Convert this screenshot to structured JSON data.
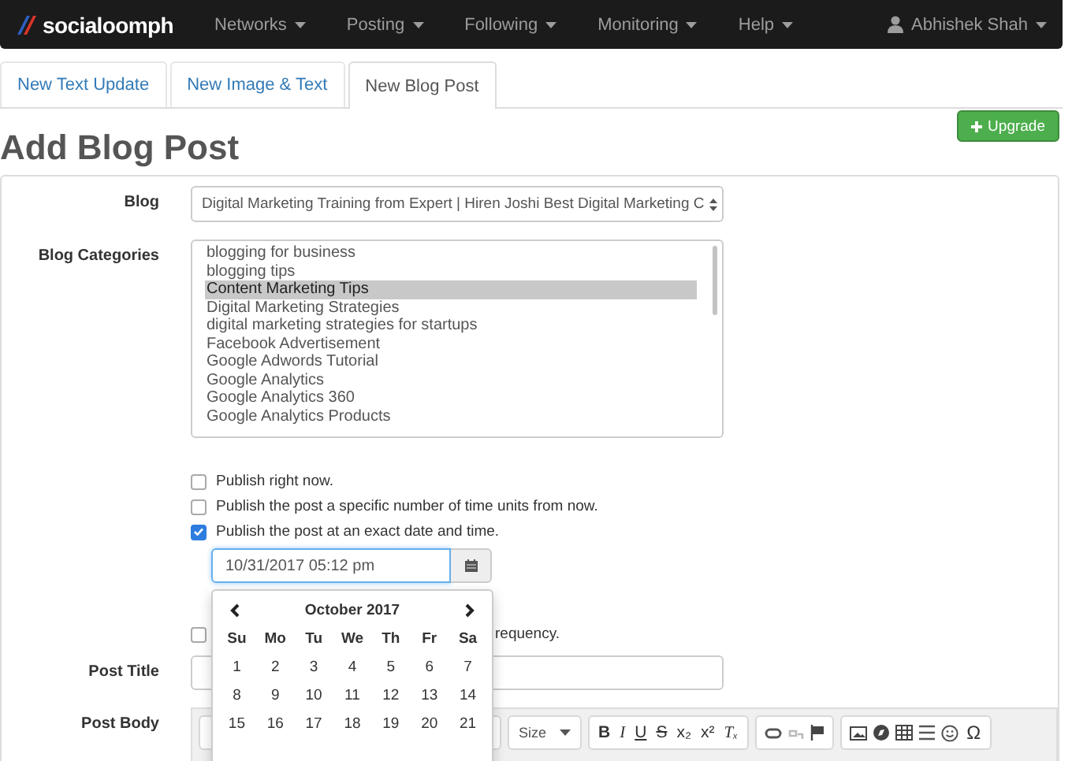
{
  "navbar": {
    "logo": "socialoomph",
    "menus": [
      "Networks",
      "Posting",
      "Following",
      "Monitoring",
      "Help"
    ],
    "user": "Abhishek Shah"
  },
  "tabs": [
    {
      "label": "New Text Update",
      "selected": false
    },
    {
      "label": "New Image & Text",
      "selected": false
    },
    {
      "label": "New Blog Post",
      "selected": true
    }
  ],
  "upgrade_button": "Upgrade",
  "heading": "Add Blog Post",
  "blog": {
    "label": "Blog",
    "value": "Digital Marketing Training from Expert | Hiren Joshi Best Digital Marketing C"
  },
  "categories": {
    "label": "Blog Categories",
    "items": [
      {
        "label": "blogging for business",
        "selected": false
      },
      {
        "label": "blogging tips",
        "selected": false
      },
      {
        "label": "Content Marketing Tips",
        "selected": true
      },
      {
        "label": "Digital Marketing Strategies",
        "selected": false
      },
      {
        "label": "digital marketing strategies for startups",
        "selected": false
      },
      {
        "label": "Facebook Advertisement",
        "selected": false
      },
      {
        "label": "Google Adwords Tutorial",
        "selected": false
      },
      {
        "label": "Google Analytics",
        "selected": false
      },
      {
        "label": "Google Analytics 360",
        "selected": false
      },
      {
        "label": "Google Analytics Products",
        "selected": false
      }
    ]
  },
  "publish_options": [
    {
      "label": "Publish right now.",
      "checked": false
    },
    {
      "label": "Publish the post a specific number of time units from now.",
      "checked": false
    },
    {
      "label": "Publish the post at an exact date and time.",
      "checked": true
    }
  ],
  "date_field": {
    "value": "10/31/2017 05:12 pm"
  },
  "frequency_option": {
    "label": "requency.",
    "checked": false
  },
  "calendar": {
    "month": "October 2017",
    "weekdays": [
      "Su",
      "Mo",
      "Tu",
      "We",
      "Th",
      "Fr",
      "Sa"
    ],
    "weeks": [
      [
        "1",
        "2",
        "3",
        "4",
        "5",
        "6",
        "7"
      ],
      [
        "8",
        "9",
        "10",
        "11",
        "12",
        "13",
        "14"
      ],
      [
        "15",
        "16",
        "17",
        "18",
        "19",
        "20",
        "21"
      ]
    ]
  },
  "post_title": {
    "label": "Post Title"
  },
  "post_body": {
    "label": "Post Body",
    "size_dropdown": "Size",
    "format_buttons": [
      "B",
      "I",
      "U",
      "S",
      "x₂",
      "x²",
      "Tₓ"
    ],
    "symbol_button": "Ω"
  }
}
